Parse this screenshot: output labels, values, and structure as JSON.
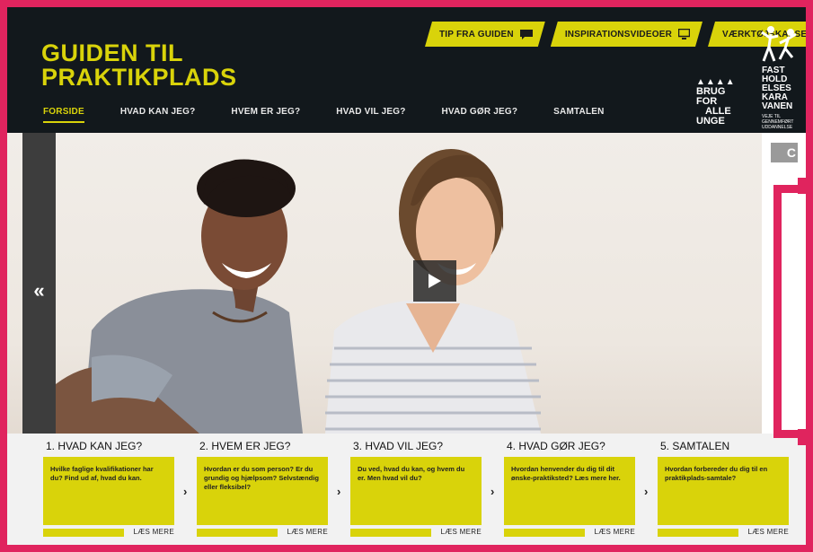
{
  "header": {
    "logo_line1": "GUIDEN TIL",
    "logo_line2": "PRAKTIKPLADS",
    "top_buttons": [
      {
        "label": "TIP FRA GUIDEN",
        "icon": "speech-bubble-icon"
      },
      {
        "label": "INSPIRATIONSVIDEOER",
        "icon": "monitor-icon"
      },
      {
        "label": "VÆRKTØJSKASSE",
        "icon": "wrench-icon"
      }
    ],
    "nav": [
      "FORSIDE",
      "HVAD KAN JEG?",
      "HVEM ER JEG?",
      "HVAD VIL JEG?",
      "HVAD GØR JEG?",
      "SAMTALEN"
    ],
    "active_nav": "FORSIDE",
    "brug_logo": [
      "BRUG",
      "FOR",
      "ALLE",
      "UNGE"
    ],
    "fast_logo": [
      "FAST",
      "HOLD",
      "ELSES",
      "KARA",
      "VANEN"
    ],
    "fast_small": "VEJE TIL GENNEMFØRT UDDANNELSE"
  },
  "hero": {
    "prev_arrow": "«",
    "side_tab": "C"
  },
  "cards": [
    {
      "title": "1. HVAD KAN JEG?",
      "text": "Hvilke faglige kvalifikationer har du? Find ud af, hvad du kan.",
      "more": "LÆS MERE"
    },
    {
      "title": "2. HVEM ER JEG?",
      "text": "Hvordan er du som person? Er du grundig og hjælpsom? Selvstændig eller fleksibel?",
      "more": "LÆS MERE"
    },
    {
      "title": "3. HVAD VIL JEG?",
      "text": "Du ved, hvad du kan, og hvem du er. Men hvad vil du?",
      "more": "LÆS MERE"
    },
    {
      "title": "4. HVAD GØR JEG?",
      "text": "Hvordan henvender du dig til dit ønske-praktiksted? Læs mere her.",
      "more": "LÆS MERE"
    },
    {
      "title": "5. SAMTALEN",
      "text": "Hvordan forbereder du dig til en praktikplads-samtale?",
      "more": "LÆS MERE"
    }
  ],
  "chevron": "›",
  "colors": {
    "accent": "#d9d30a",
    "header_bg": "#12181c",
    "frame": "#e0245e"
  }
}
